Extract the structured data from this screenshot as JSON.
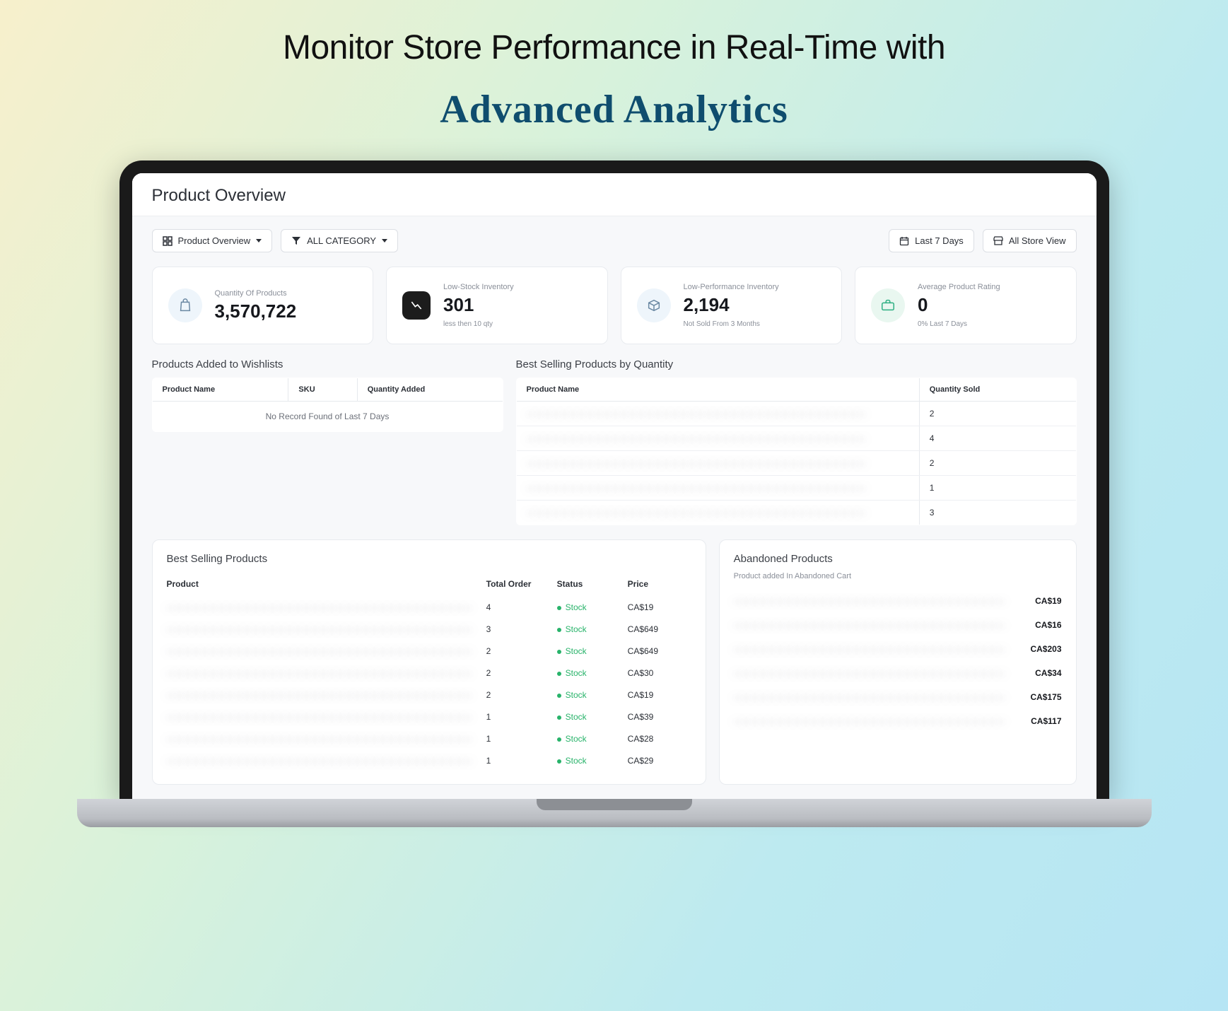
{
  "hero": {
    "line1": "Monitor Store Performance in Real-Time with",
    "line2": "Advanced Analytics"
  },
  "header": {
    "title": "Product Overview"
  },
  "toolbar": {
    "overview_label": "Product Overview",
    "category_label": "ALL CATEGORY",
    "daterange_label": "Last 7 Days",
    "storeview_label": "All Store View"
  },
  "kpi": [
    {
      "label": "Quantity Of Products",
      "value": "3,570,722",
      "sub": ""
    },
    {
      "label": "Low-Stock Inventory",
      "value": "301",
      "sub": "less then 10 qty"
    },
    {
      "label": "Low-Performance Inventory",
      "value": "2,194",
      "sub": "Not Sold From 3 Months"
    },
    {
      "label": "Average Product Rating",
      "value": "0",
      "sub": "0% Last 7 Days"
    }
  ],
  "wishlist": {
    "title": "Products Added to Wishlists",
    "cols": {
      "product": "Product Name",
      "sku": "SKU",
      "qty": "Quantity Added"
    },
    "empty": "No Record Found of Last 7 Days"
  },
  "bestqty": {
    "title": "Best Selling Products by Quantity",
    "cols": {
      "product": "Product Name",
      "qty": "Quantity Sold"
    },
    "rows": [
      {
        "name": "——",
        "qty": "2"
      },
      {
        "name": "——",
        "qty": "4"
      },
      {
        "name": "——",
        "qty": "2"
      },
      {
        "name": "——",
        "qty": "1"
      },
      {
        "name": "——",
        "qty": "3"
      }
    ]
  },
  "bsp": {
    "title": "Best Selling Products",
    "cols": {
      "product": "Product",
      "total": "Total Order",
      "status": "Status",
      "price": "Price"
    },
    "stock_label": "Stock",
    "rows": [
      {
        "product": "——",
        "total": "4",
        "price": "CA$19"
      },
      {
        "product": "——",
        "total": "3",
        "price": "CA$649"
      },
      {
        "product": "——",
        "total": "2",
        "price": "CA$649"
      },
      {
        "product": "——",
        "total": "2",
        "price": "CA$30"
      },
      {
        "product": "——",
        "total": "2",
        "price": "CA$19"
      },
      {
        "product": "——",
        "total": "1",
        "price": "CA$39"
      },
      {
        "product": "——",
        "total": "1",
        "price": "CA$28"
      },
      {
        "product": "——",
        "total": "1",
        "price": "CA$29"
      }
    ]
  },
  "abandoned": {
    "title": "Abandoned Products",
    "subtitle": "Product added In Abandoned Cart",
    "rows": [
      {
        "name": "——",
        "price": "CA$19"
      },
      {
        "name": "——",
        "price": "CA$16"
      },
      {
        "name": "——",
        "price": "CA$203"
      },
      {
        "name": "——",
        "price": "CA$34"
      },
      {
        "name": "——",
        "price": "CA$175"
      },
      {
        "name": "——",
        "price": "CA$117"
      }
    ]
  }
}
